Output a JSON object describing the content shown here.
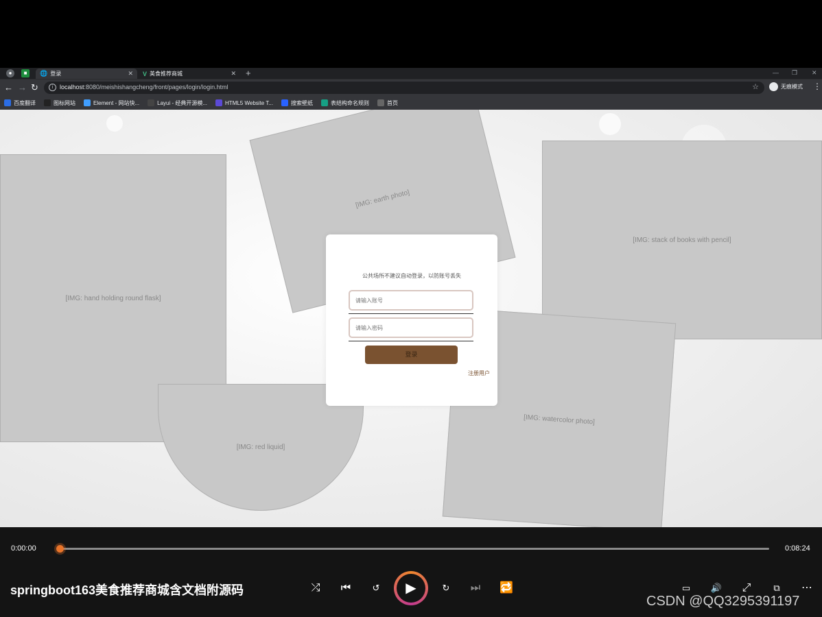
{
  "browser": {
    "tabs": [
      {
        "title": "登录",
        "active": true
      },
      {
        "title": "美食推荐商城",
        "active": false
      }
    ],
    "url_host": "localhost",
    "url_path": ":8080/meishishangcheng/front/pages/login/login.html",
    "profile_label": "无痕模式",
    "bookmarks": [
      {
        "label": "百度翻译",
        "icon": "translate-icon",
        "color": "#2b6de5"
      },
      {
        "label": "图标网站",
        "icon": "flag-icon",
        "color": "#222222"
      },
      {
        "label": "Element - 网站快...",
        "icon": "element-icon",
        "color": "#409eff"
      },
      {
        "label": "Layui - 经典开源模...",
        "icon": "layui-icon",
        "color": "#444444"
      },
      {
        "label": "HTML5 Website T...",
        "icon": "html5-icon",
        "color": "#5b4ad6"
      },
      {
        "label": "搜索壁纸",
        "icon": "wallpaper-icon",
        "color": "#2962ff"
      },
      {
        "label": "表结构命名规则",
        "icon": "table-icon",
        "color": "#16a085"
      },
      {
        "label": "首页",
        "icon": "globe-icon",
        "color": "#666666"
      }
    ]
  },
  "login": {
    "notice": "公共场所不建议自动登录，以防账号丢失",
    "username_placeholder": "请输入账号",
    "password_placeholder": "请输入密码",
    "login_label": "登录",
    "register_label": "注册用户"
  },
  "player": {
    "current_time": "0:00:00",
    "total_time": "0:08:24",
    "progress": 0,
    "title": "springboot163美食推荐商城含文档附源码",
    "accent": "#e8742a"
  },
  "watermark": "CSDN @QQ3295391197"
}
